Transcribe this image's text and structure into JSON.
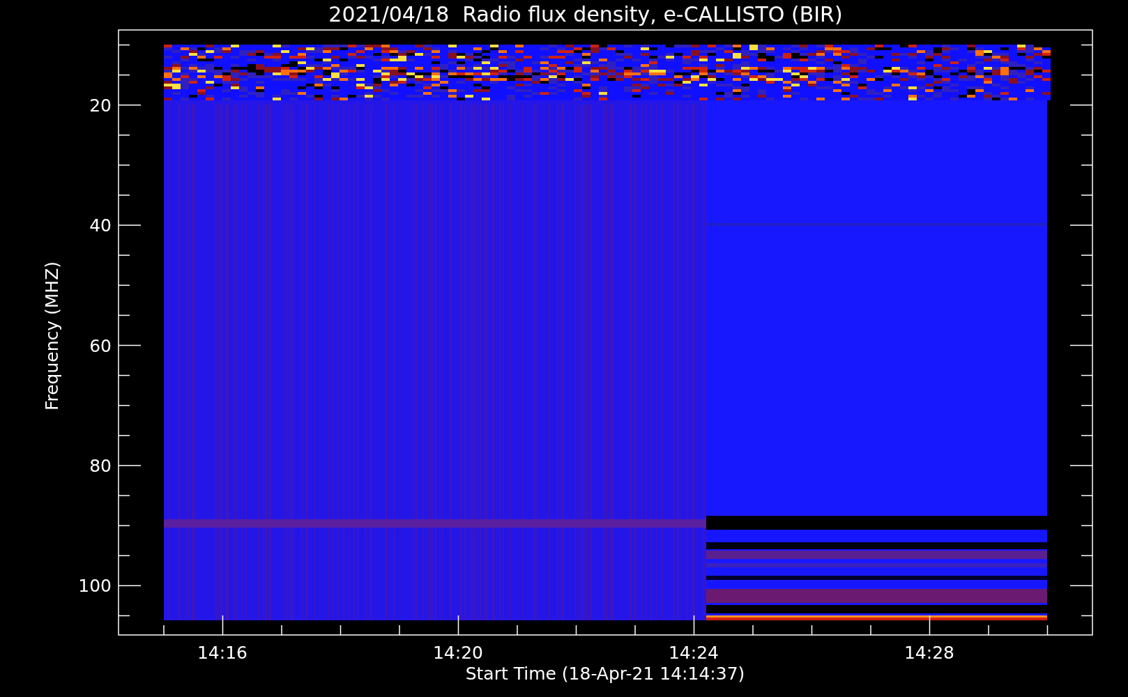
{
  "title": "2021/04/18  Radio flux density, e-CALLISTO (BIR)",
  "y_axis": {
    "label": "Frequency (MHZ)",
    "ticks": [
      "20",
      "40",
      "60",
      "80",
      "100"
    ]
  },
  "x_axis": {
    "label": "Start Time (18-Apr-21 14:14:37)",
    "ticks": [
      "14:16",
      "14:20",
      "14:24",
      "14:28"
    ]
  }
}
